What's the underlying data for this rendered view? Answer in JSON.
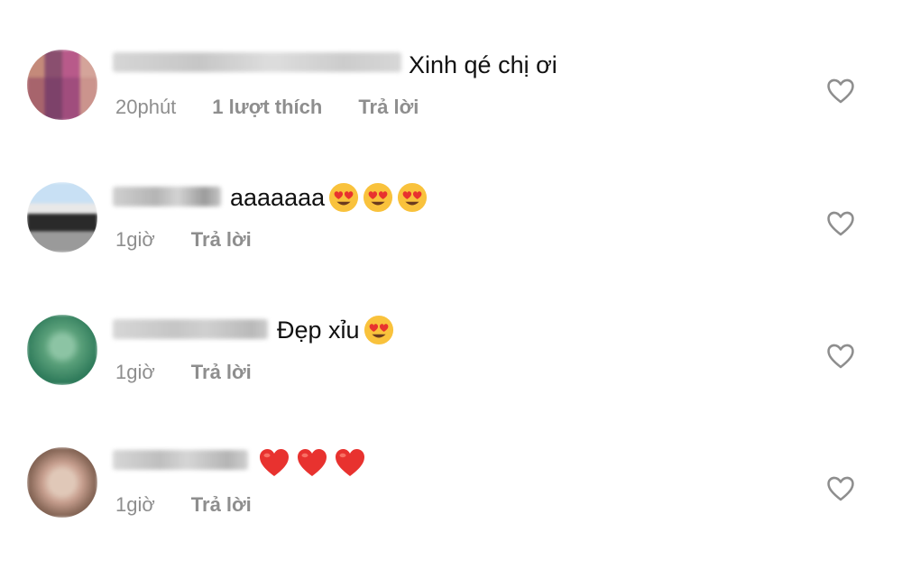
{
  "comments": [
    {
      "text": "Xinh qé chị ơi",
      "emojis": [],
      "time": "20phút",
      "likes": "1 lượt thích",
      "reply": "Trả lời",
      "avatar_colors": [
        "#b85a5a",
        "#7a3f6a",
        "#c47a8a",
        "#e0b0a0"
      ]
    },
    {
      "text": "aaaaaaa",
      "emojis": [
        "heart-eyes-face",
        "heart-eyes-face",
        "heart-eyes-face"
      ],
      "time": "1giờ",
      "reply": "Trả lời",
      "avatar_colors": [
        "#b8d4ec",
        "#2a2a2a",
        "#7a7a7a",
        "#c0c0c0"
      ]
    },
    {
      "text": "Đẹp xỉu",
      "emojis": [
        "heart-eyes-face"
      ],
      "time": "1giờ",
      "reply": "Trả lời",
      "avatar_colors": [
        "#5aa07a",
        "#2e7a5a",
        "#8cc4a4",
        "#3e8c6a"
      ]
    },
    {
      "text": "",
      "emojis": [
        "red-heart",
        "red-heart",
        "red-heart"
      ],
      "time": "1giờ",
      "reply": "Trả lời",
      "avatar_colors": [
        "#8a6a5a",
        "#c8a090",
        "#5a4036",
        "#e0c8b8"
      ]
    }
  ],
  "colors": {
    "meta_text": "#8e8e8e",
    "heart_outline": "#8e8e8e",
    "emoji_heart_red": "#e8322f",
    "emoji_face_yellow": "#f9c23c"
  },
  "icons": {
    "like": "heart-outline-icon"
  }
}
